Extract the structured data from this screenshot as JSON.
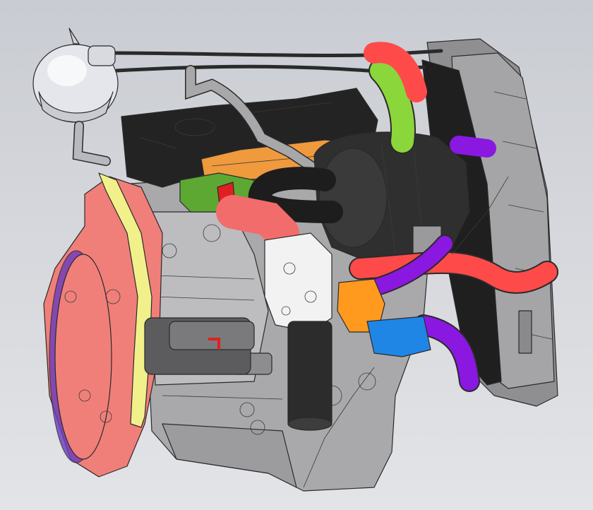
{
  "viewport": {
    "background_top": "#c9ccd2",
    "background_bottom": "#e3e4e7"
  },
  "model": {
    "parts": [
      {
        "name": "expansion-tank",
        "color": "#e4e6ec"
      },
      {
        "name": "valve-cover",
        "color": "#2b2b2b"
      },
      {
        "name": "intake-manifold",
        "color": "#f09a3e"
      },
      {
        "name": "flywheel-housing",
        "color": "#f07f7a"
      },
      {
        "name": "gasket-ring",
        "color": "#f2f08a"
      },
      {
        "name": "engine-block",
        "color": "#a9a9ab"
      },
      {
        "name": "air-filter",
        "color": "#2f2f2f"
      },
      {
        "name": "radiator",
        "color": "#9c9c9e"
      },
      {
        "name": "charge-air-pipe",
        "color": "#ff4a4a"
      },
      {
        "name": "coolant-hose-purple",
        "color": "#8a18e0"
      },
      {
        "name": "intake-hose-green",
        "color": "#8bd63a"
      },
      {
        "name": "thermostat-housing",
        "color": "#ff9a1f"
      },
      {
        "name": "water-pump-blue",
        "color": "#1f86e6"
      },
      {
        "name": "oil-filter",
        "color": "#2c2c2c"
      },
      {
        "name": "egr-valve",
        "color": "#5da832"
      },
      {
        "name": "starter-motor",
        "color": "#6b6b6b"
      },
      {
        "name": "fuel-pump-white",
        "color": "#f2f2f2"
      }
    ]
  }
}
